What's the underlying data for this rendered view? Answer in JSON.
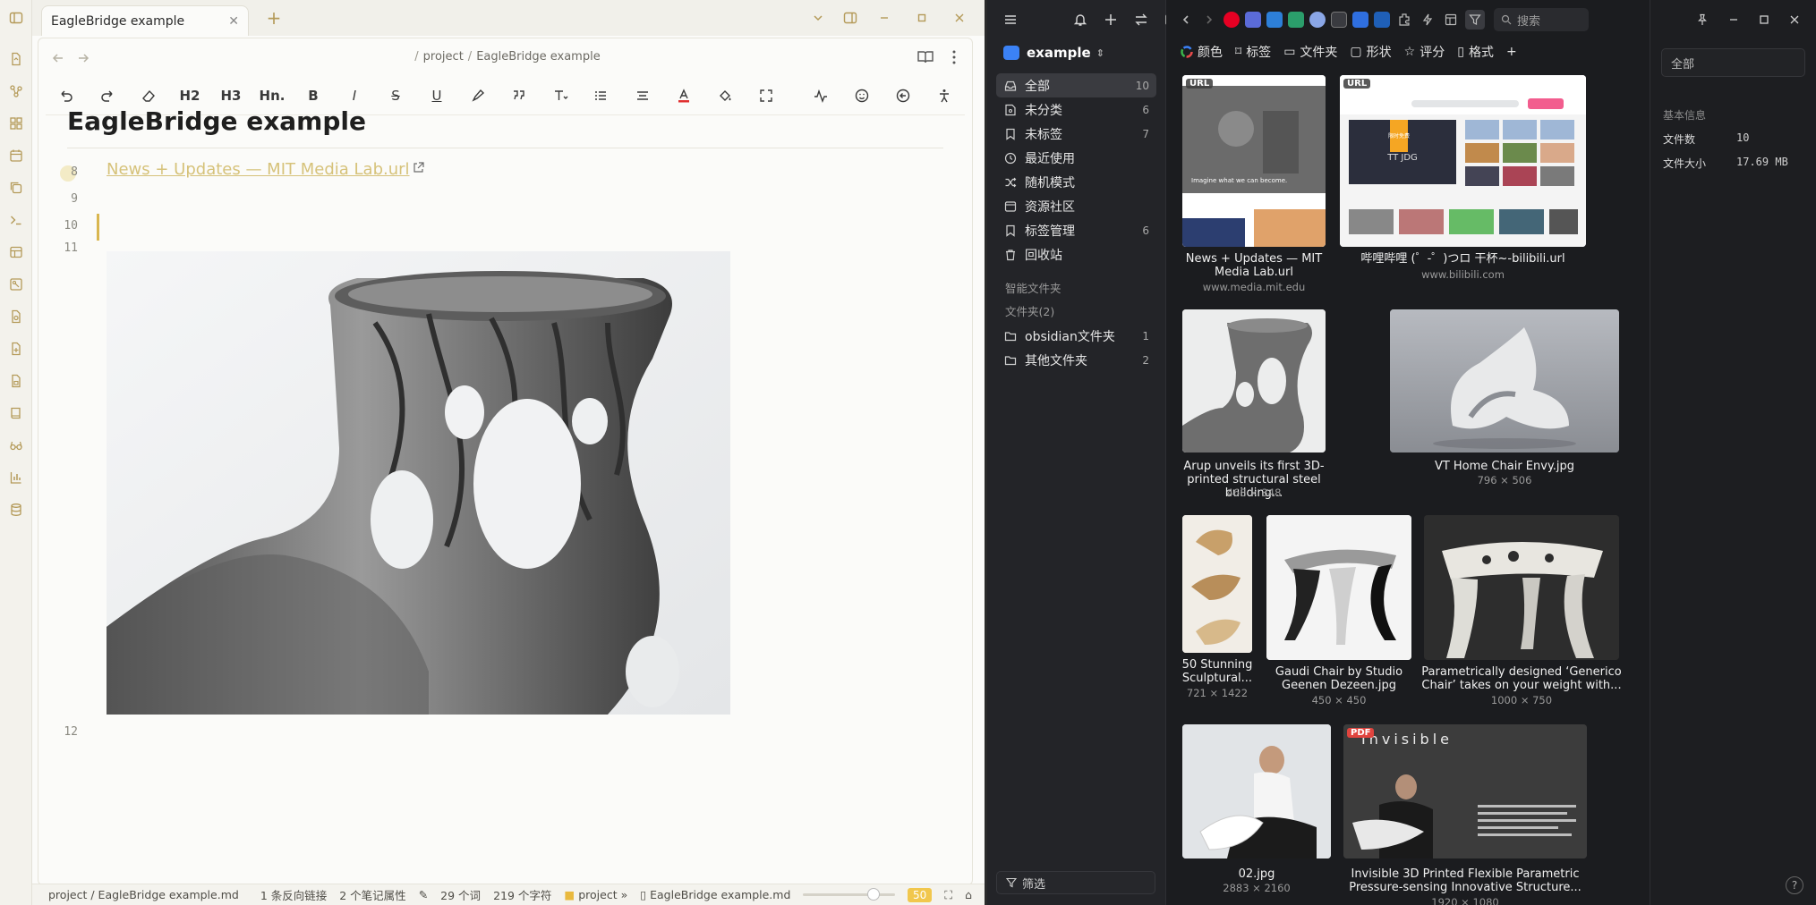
{
  "obsidian": {
    "tab_title": "EagleBridge example",
    "breadcrumb": {
      "folder": "project",
      "file": "EagleBridge example"
    },
    "toolbar": {
      "h2": "H2",
      "h3": "H3",
      "hn": "Hn."
    },
    "doc": {
      "title": "EagleBridge example",
      "link_text": "News + Updates — MIT Media Lab.url",
      "line_numbers": [
        "8",
        "9",
        "10",
        "11",
        "12"
      ]
    },
    "status": {
      "path": "project / EagleBridge example.md",
      "backlinks": "1 条反向链接",
      "properties": "2 个笔记属性",
      "words": "29 个词",
      "chars": "219 个字符",
      "folder": "project »",
      "file": "EagleBridge example.md",
      "zoom": "50"
    }
  },
  "eagle": {
    "library_name": "example",
    "sidebar": {
      "items": [
        {
          "label": "全部",
          "count": "10",
          "icon": "inbox-icon"
        },
        {
          "label": "未分类",
          "count": "6",
          "icon": "unsorted-icon"
        },
        {
          "label": "未标签",
          "count": "7",
          "icon": "untagged-icon"
        },
        {
          "label": "最近使用",
          "count": "",
          "icon": "clock-icon"
        },
        {
          "label": "随机模式",
          "count": "",
          "icon": "shuffle-icon"
        },
        {
          "label": "资源社区",
          "count": "",
          "icon": "community-icon"
        },
        {
          "label": "标签管理",
          "count": "6",
          "icon": "tag-icon"
        },
        {
          "label": "回收站",
          "count": "",
          "icon": "trash-icon"
        }
      ],
      "smart_folders": "智能文件夹",
      "folders_header": "文件夹(2)",
      "folders": [
        {
          "label": "obsidian文件夹",
          "count": "1"
        },
        {
          "label": "其他文件夹",
          "count": "2"
        }
      ],
      "filter_label": "筛选"
    },
    "search_placeholder": "搜索",
    "filters": [
      "颜色",
      "标签",
      "文件夹",
      "形状",
      "评分",
      "格式"
    ],
    "cards": [
      {
        "name": "News + Updates — MIT Media Lab.url",
        "meta": "www.media.mit.edu",
        "badge": "URL"
      },
      {
        "name": "哔哩哔哩 (゜-゜)つロ 干杯~-bilibili.url",
        "meta": "www.bilibili.com",
        "badge": "URL"
      },
      {
        "name": "Arup unveils its first 3D-printed structural steel building...",
        "meta": "468 × 348",
        "badge": ""
      },
      {
        "name": "VT Home Chair Envy.jpg",
        "meta": "796 × 506",
        "badge": ""
      },
      {
        "name": "50 Stunning Sculptural...",
        "meta": "721 × 1422",
        "badge": ""
      },
      {
        "name": "Gaudi Chair by Studio Geenen Dezeen.jpg",
        "meta": "450 × 450",
        "badge": ""
      },
      {
        "name": "Parametrically designed ‘Generico Chair’ takes on your weight with...",
        "meta": "1000 × 750",
        "badge": ""
      },
      {
        "name": "02.jpg",
        "meta": "2883 × 2160",
        "badge": ""
      },
      {
        "name": "Invisible 3D Printed Flexible Parametric Pressure-sensing Innovative Structure...",
        "meta": "1920 × 1080",
        "badge": "PDF"
      }
    ],
    "thumb_text": {
      "mit_overlay": "Imagine what we can become.",
      "bili_banner": "限时免费",
      "invisible_title": "Invisible"
    },
    "info": {
      "all_label": "全部",
      "section": "基本信息",
      "file_count_label": "文件数",
      "file_count": "10",
      "size_label": "文件大小",
      "size": "17.69 MB"
    }
  }
}
